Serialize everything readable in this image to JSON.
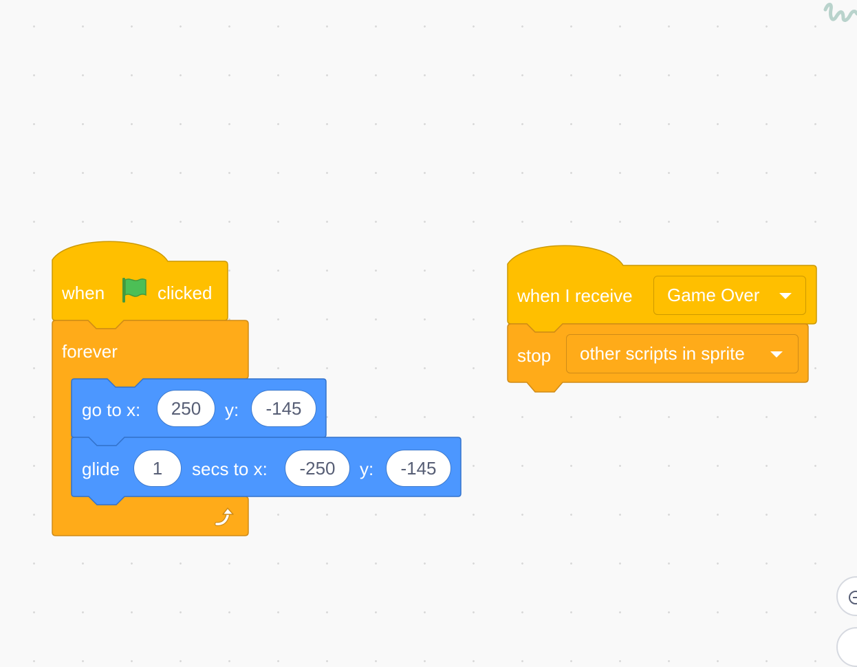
{
  "colors": {
    "events": "#ffbf00",
    "events_border": "#cc9900",
    "control": "#ffab19",
    "control_border": "#cf8b17",
    "motion": "#4c97ff",
    "motion_border": "#3373cc",
    "flag_green": "#4cbf56"
  },
  "script1": {
    "hat": {
      "when": "when",
      "flag_icon": "green-flag-icon",
      "clicked": "clicked"
    },
    "forever": {
      "label": "forever",
      "loop_icon": "loop-arrow-icon"
    },
    "goto": {
      "label_x": "go to x:",
      "x": "250",
      "label_y": "y:",
      "y": "-145"
    },
    "glide": {
      "label": "glide",
      "secs": "1",
      "label_secs_to_x": "secs to x:",
      "x": "-250",
      "label_y": "y:",
      "y": "-145"
    }
  },
  "script2": {
    "hat": {
      "label": "when I receive",
      "message": "Game Over"
    },
    "stop": {
      "label": "stop",
      "option": "other scripts in sprite"
    }
  }
}
